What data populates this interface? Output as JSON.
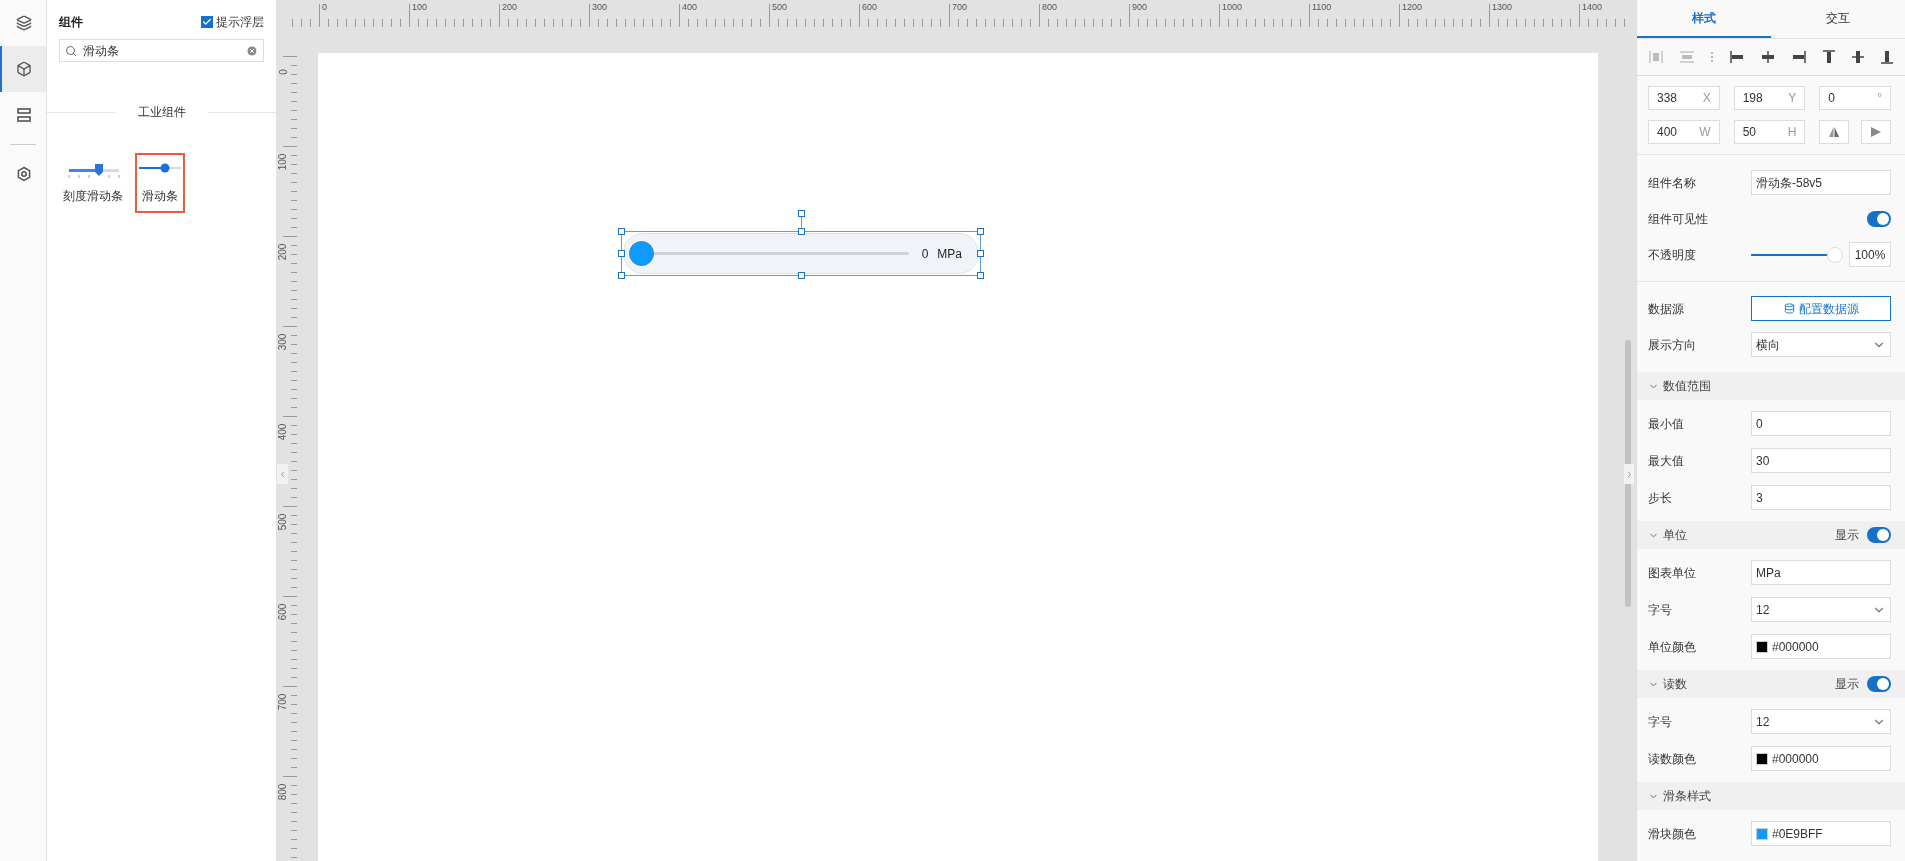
{
  "rail": {
    "items": [
      {
        "selected": false
      },
      {
        "selected": true
      },
      {
        "selected": false
      },
      {
        "selected": false
      }
    ]
  },
  "components_panel": {
    "title": "组件",
    "overlay_checkbox": {
      "label": "提示浮层",
      "checked": true
    },
    "search": {
      "value": "滑动条"
    },
    "group_title": "工业组件",
    "items": [
      {
        "kind": "scale-slider",
        "label": "刻度滑动条",
        "selected": false
      },
      {
        "kind": "slider",
        "label": "滑动条",
        "selected": true
      }
    ]
  },
  "ruler": {
    "x_labels": [
      "0",
      "100",
      "200",
      "300",
      "400",
      "500",
      "600",
      "700",
      "800",
      "900",
      "1000",
      "1100",
      "1200",
      "1300",
      "1400"
    ],
    "y_labels": [
      "0",
      "100",
      "200",
      "300",
      "400",
      "500",
      "600",
      "700",
      "800"
    ]
  },
  "canvas": {
    "widget": {
      "selected": true,
      "level": 0,
      "reading": "0",
      "unit": "MPa"
    }
  },
  "inspector": {
    "tabs": [
      {
        "label": "样式",
        "selected": true
      },
      {
        "label": "交互",
        "selected": false
      }
    ],
    "geometry": [
      {
        "value": "338",
        "unit": "X"
      },
      {
        "value": "198",
        "unit": "Y"
      },
      {
        "value": "0",
        "unit": "°"
      },
      {
        "value": "400",
        "unit": "W"
      },
      {
        "value": "50",
        "unit": "H"
      }
    ],
    "name_row": {
      "label": "组件名称",
      "value": "滑动条-58v5"
    },
    "visibility": {
      "label": "组件可见性",
      "on": true
    },
    "opacity": {
      "label": "不透明度",
      "level": 1,
      "reading": "100%"
    },
    "datasource": {
      "label": "数据源",
      "button": "配置数据源"
    },
    "direction": {
      "label": "展示方向",
      "value": "横向"
    },
    "sections": [
      {
        "title": "数值范围",
        "expanded": true,
        "rows": [
          {
            "kind": "input",
            "label": "最小值",
            "value": "0"
          },
          {
            "kind": "input",
            "label": "最大值",
            "value": "30"
          },
          {
            "kind": "input",
            "label": "步长",
            "value": "3"
          }
        ]
      },
      {
        "title": "单位",
        "expanded": true,
        "show": {
          "label": "显示",
          "on": true
        },
        "rows": [
          {
            "kind": "input",
            "label": "图表单位",
            "value": "MPa"
          },
          {
            "kind": "select",
            "label": "字号",
            "value": "12"
          },
          {
            "kind": "color",
            "label": "单位颜色",
            "value": "#000000",
            "color": "#000000"
          }
        ]
      },
      {
        "title": "读数",
        "expanded": true,
        "show": {
          "label": "显示",
          "on": true
        },
        "rows": [
          {
            "kind": "select",
            "label": "字号",
            "value": "12"
          },
          {
            "kind": "color",
            "label": "读数颜色",
            "value": "#000000",
            "color": "#000000"
          }
        ]
      },
      {
        "title": "滑条样式",
        "expanded": true,
        "rows": [
          {
            "kind": "color",
            "label": "滑块颜色",
            "value": "#0E9BFF",
            "color": "#0e9bff"
          }
        ]
      }
    ]
  }
}
